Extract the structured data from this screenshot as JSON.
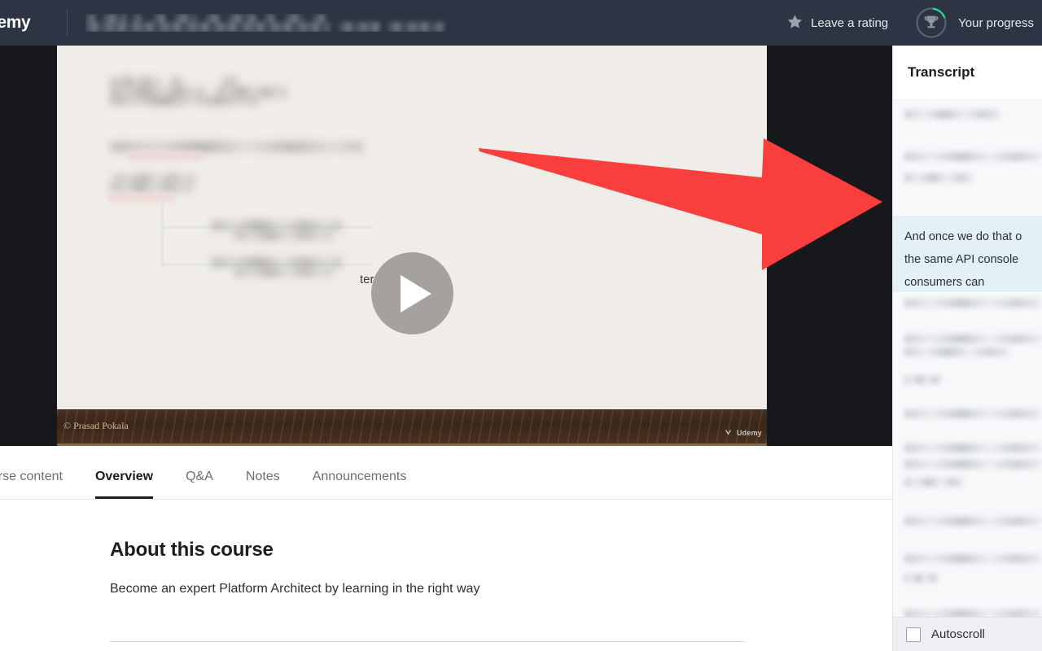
{
  "header": {
    "logo_text": "demy",
    "logo_icon": "udemy-logo",
    "course_title": "",
    "rating": {
      "label": "Leave a rating",
      "icon": "star-icon"
    },
    "progress": {
      "label": "Your progress",
      "icon": "trophy-icon",
      "percent": 15,
      "ring_color": "#2FD48A",
      "ring_track_color": "#5a626f"
    },
    "background_color": "#2D3544"
  },
  "video": {
    "state": "paused",
    "play_button_icon": "play-icon",
    "background_color": "#17181C",
    "slide_background_color": "#F0EDE8",
    "visible_slide_text": "ter",
    "copyright": "© Prasad Pokala",
    "watermark": "Udemy",
    "highlight_color": "#EDD8D6"
  },
  "annotation": {
    "type": "arrow",
    "icon": "red-arrow-annotation",
    "color": "#F93E3E",
    "direction": "right",
    "points_to": "transcript-panel"
  },
  "tabs": [
    {
      "label": "ourse content",
      "active": false,
      "name": "tab-course-content"
    },
    {
      "label": "Overview",
      "active": true,
      "name": "tab-overview"
    },
    {
      "label": "Q&A",
      "active": false,
      "name": "tab-qa"
    },
    {
      "label": "Notes",
      "active": false,
      "name": "tab-notes"
    },
    {
      "label": "Announcements",
      "active": false,
      "name": "tab-announcements"
    }
  ],
  "overview": {
    "heading": "About this course",
    "description": "Become an expert Platform Architect by learning in the right way"
  },
  "transcript": {
    "title": "Transcript",
    "active_cue": {
      "line1": "And once we do that o",
      "line2": "the same API console",
      "line3": "consumers can",
      "highlight_color": "#E3F0F5"
    },
    "autoscroll": {
      "label": "Autoscroll",
      "checked": false
    },
    "panel_background": "#F7F8FA"
  }
}
